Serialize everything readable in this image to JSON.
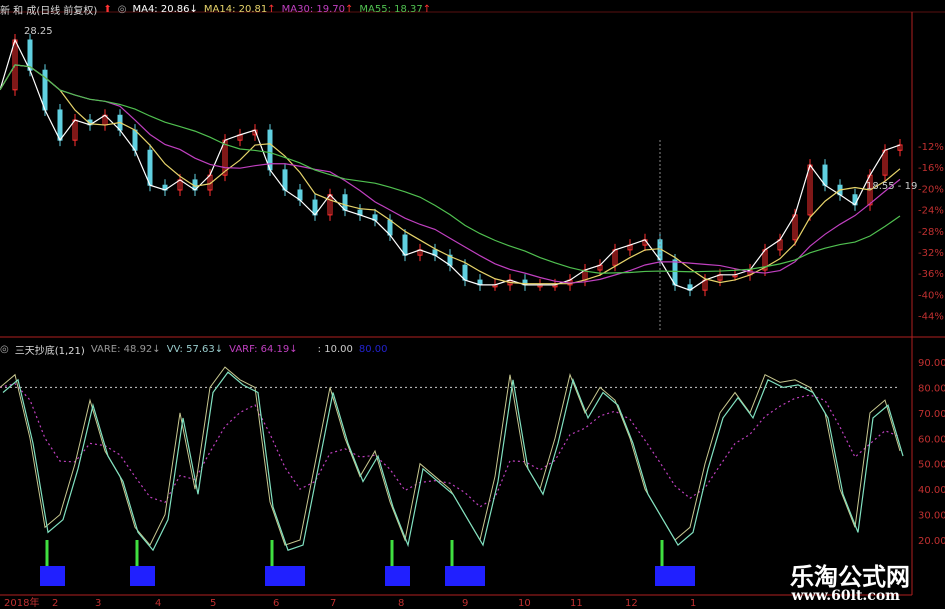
{
  "price_header": {
    "title": "新 和 成(日线 前复权)",
    "ma4": "MA4: 20.86",
    "ma14": "MA14: 20.81",
    "ma30": "MA30: 19.70",
    "ma55": "MA55: 18.37",
    "arrow_down": "↓",
    "arrow_up": "↑"
  },
  "indicator_header": {
    "title": "三天抄底(1,21)",
    "vare": "VARE: 48.92",
    "vv": "VV: 57.63",
    "varf": "VARF: 64.19",
    "extra": ": 10.00",
    "extra2": "80.00",
    "arrow_down": "↓"
  },
  "high_label": "28.25",
  "cursor_label": "18.55 - 19",
  "colors": {
    "ma4": "#ffffff",
    "ma14": "#e6d36a",
    "ma30": "#c040c0",
    "ma55": "#50c050",
    "up": "#ff3030",
    "down": "#60d0e0",
    "axis": "#b02020",
    "signal": "#2020ff"
  },
  "watermark": {
    "name": "乐淘公式网",
    "url": "www.60lt.com"
  },
  "chart_data": [
    {
      "type": "line",
      "title": "新 和 成(日线 前复权)",
      "yaxis_unit": "%",
      "ylim": [
        -46,
        10
      ],
      "yticks": [
        "-12%",
        "-16%",
        "-20%",
        "-24%",
        "-28%",
        "-32%",
        "-36%",
        "-40%",
        "-44%"
      ],
      "xticks": [
        "2018年",
        "2",
        "3",
        "4",
        "5",
        "6",
        "7",
        "8",
        "9",
        "10",
        "11",
        "12",
        "1"
      ],
      "close": [
        -1.4,
        8.0,
        2.3,
        -5.2,
        -10.9,
        -7.1,
        -8.0,
        -6.2,
        -9.0,
        -12.8,
        -19.4,
        -20.3,
        -18.4,
        -20.3,
        -17.5,
        -10.9,
        -9.9,
        -9.0,
        -16.5,
        -20.3,
        -22.2,
        -25.0,
        -21.2,
        -24.1,
        -25.0,
        -26.0,
        -28.8,
        -32.6,
        -31.6,
        -32.6,
        -34.5,
        -37.3,
        -38.2,
        -38.2,
        -37.3,
        -38.2,
        -38.2,
        -38.2,
        -37.3,
        -35.4,
        -34.5,
        -31.6,
        -30.7,
        -29.7,
        -33.5,
        -38.2,
        -39.2,
        -37.3,
        -36.3,
        -36.3,
        -35.4,
        -31.6,
        -29.7,
        -25.0,
        -15.6,
        -19.4,
        -21.2,
        -23.1,
        -17.5,
        -12.8,
        -11.8
      ],
      "series": [
        {
          "name": "MA4",
          "period": 4
        },
        {
          "name": "MA14",
          "period": 14
        },
        {
          "name": "MA30",
          "period": 30
        },
        {
          "name": "MA55",
          "period": 55
        }
      ]
    },
    {
      "type": "line",
      "title": "三天抄底(1,21)",
      "ylim": [
        15,
        95
      ],
      "yticks": [
        "90.00",
        "80.00",
        "70.00",
        "60.00",
        "50.00",
        "40.00",
        "30.00",
        "20.00"
      ],
      "reference_line": 80,
      "vare": [
        80,
        85,
        60,
        25,
        30,
        50,
        75,
        55,
        45,
        25,
        18,
        30,
        70,
        40,
        80,
        88,
        83,
        80,
        35,
        18,
        20,
        50,
        80,
        60,
        45,
        55,
        35,
        20,
        50,
        45,
        40,
        30,
        20,
        45,
        85,
        50,
        40,
        60,
        85,
        70,
        80,
        75,
        60,
        40,
        30,
        20,
        25,
        50,
        70,
        78,
        70,
        85,
        82,
        83,
        80,
        70,
        40,
        25,
        70,
        75,
        55
      ],
      "signal_ranges": [
        [
          3,
          4
        ],
        [
          9,
          10
        ],
        [
          18,
          20
        ],
        [
          26,
          27
        ],
        [
          30,
          32
        ],
        [
          44,
          46
        ]
      ]
    }
  ]
}
